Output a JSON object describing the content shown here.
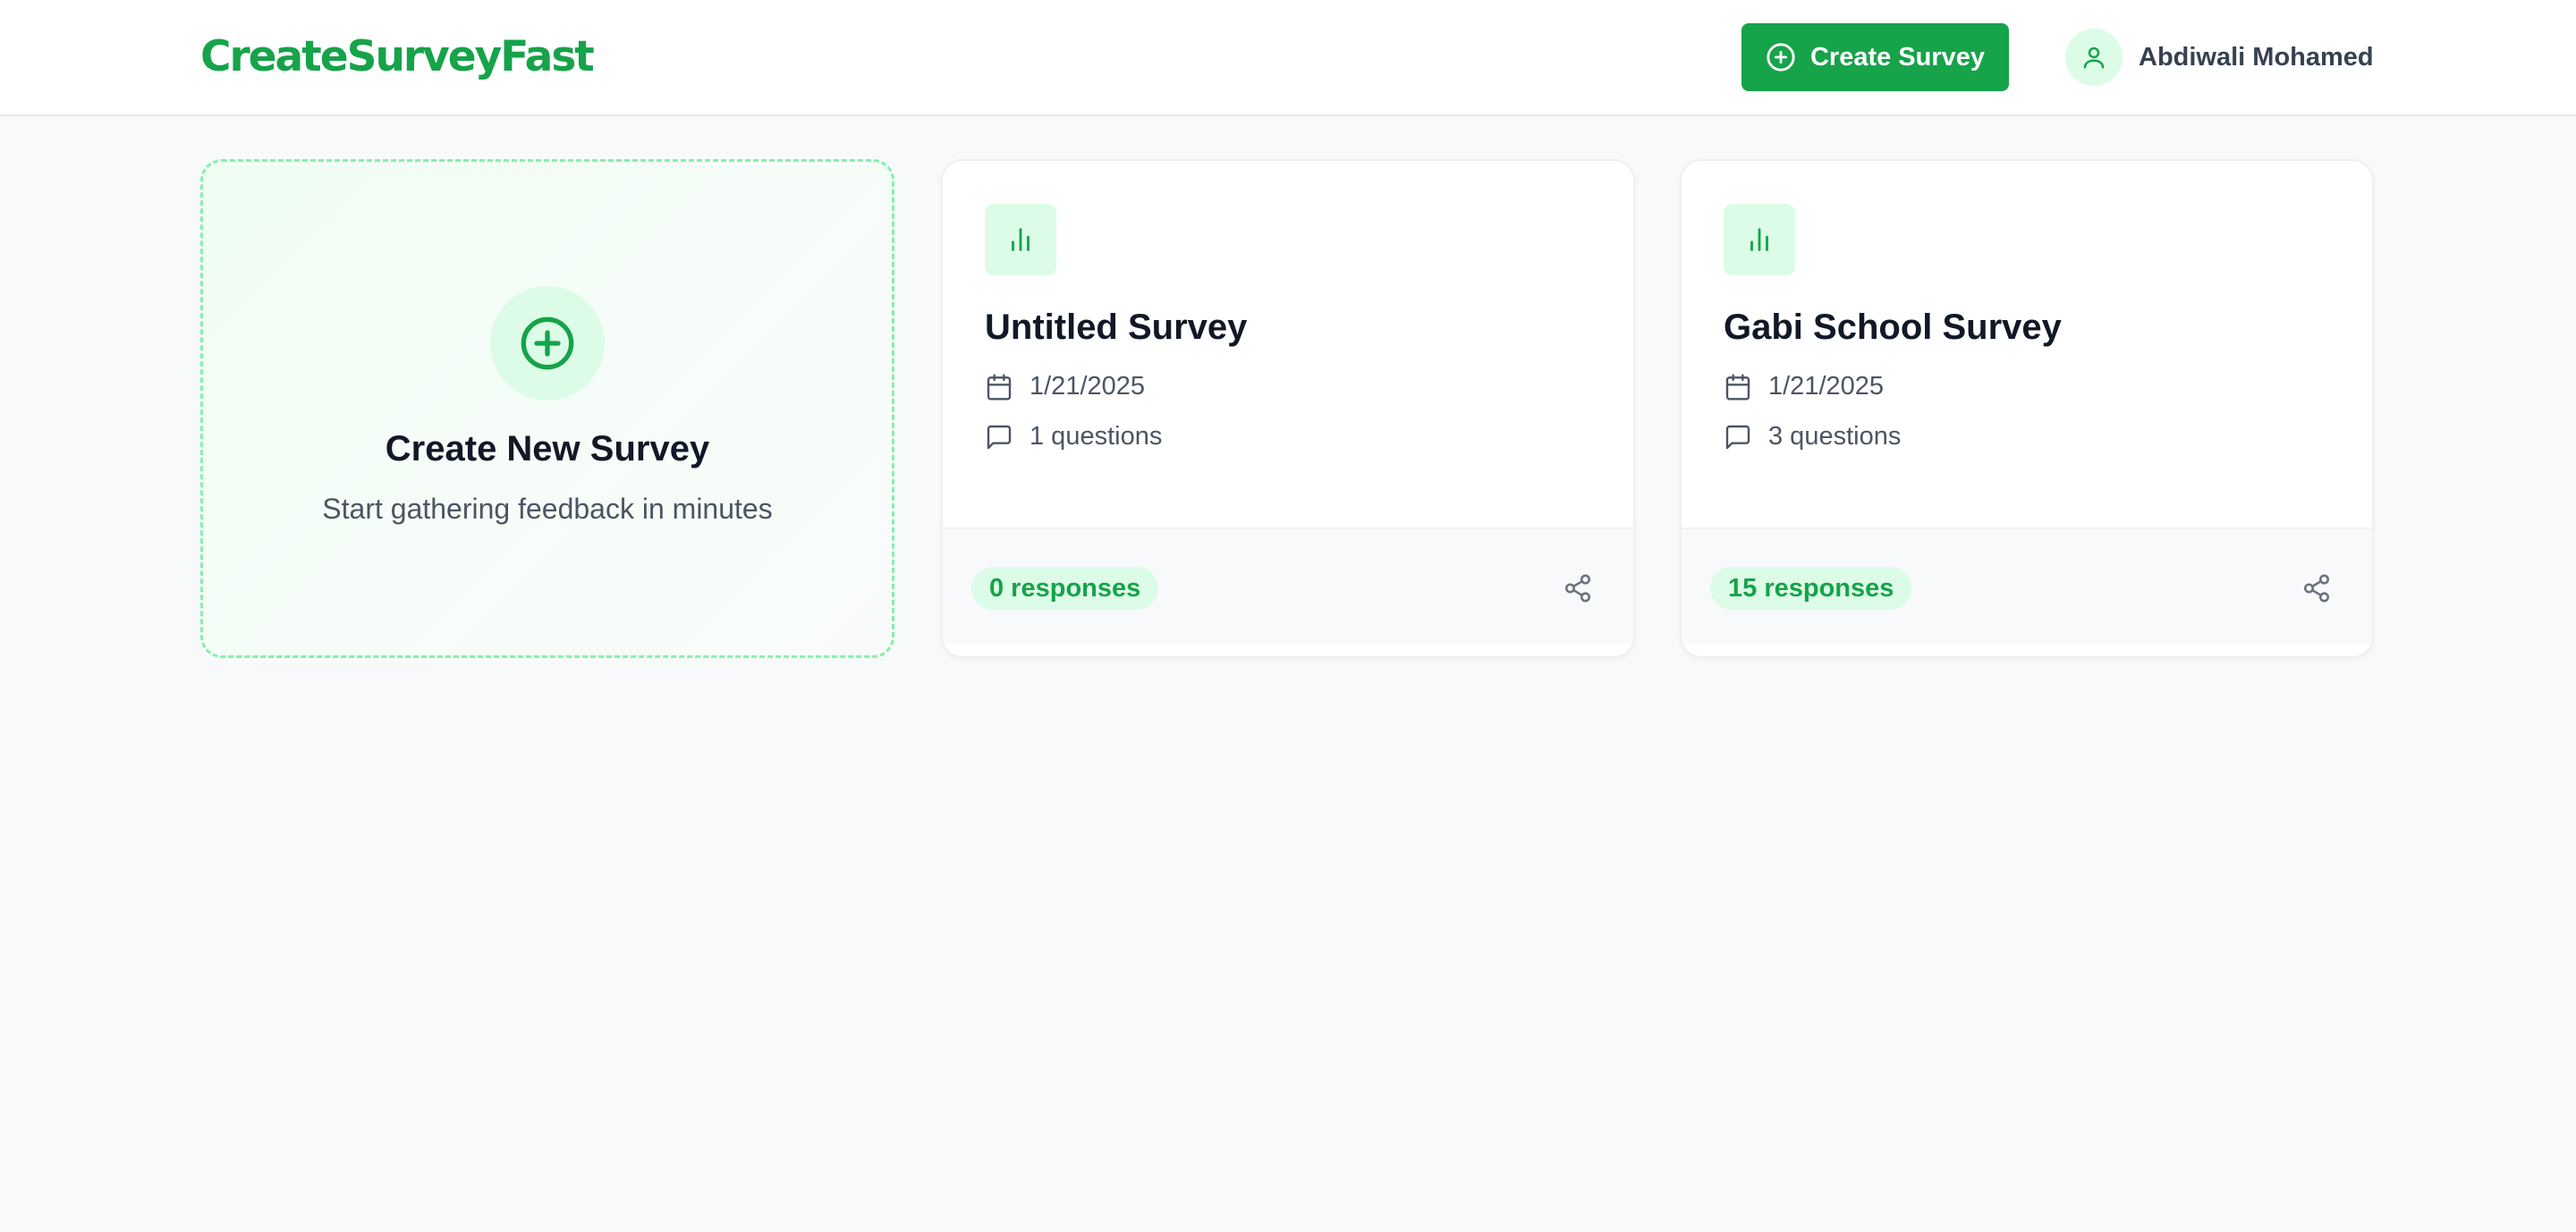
{
  "header": {
    "logo": "CreateSurveyFast",
    "create_button_label": "Create Survey",
    "create_button_icon": "plus-circle-icon",
    "user_name": "Abdiwali Mohamed",
    "user_icon": "user-icon"
  },
  "new_card": {
    "icon": "plus-circle-icon",
    "title": "Create New Survey",
    "subtitle": "Start gathering feedback in minutes"
  },
  "surveys": [
    {
      "icon": "bar-chart-icon",
      "title": "Untitled Survey",
      "date": "1/21/2025",
      "questions": "1 questions",
      "responses": "0 responses",
      "share_icon": "share-icon"
    },
    {
      "icon": "bar-chart-icon",
      "title": "Gabi School Survey",
      "date": "1/21/2025",
      "questions": "3 questions",
      "responses": "15 responses",
      "share_icon": "share-icon"
    }
  ],
  "colors": {
    "accent": "#16a34a",
    "accent_light": "#dcfce7",
    "dashed_border": "#86efac",
    "background": "#f8f9fb"
  }
}
